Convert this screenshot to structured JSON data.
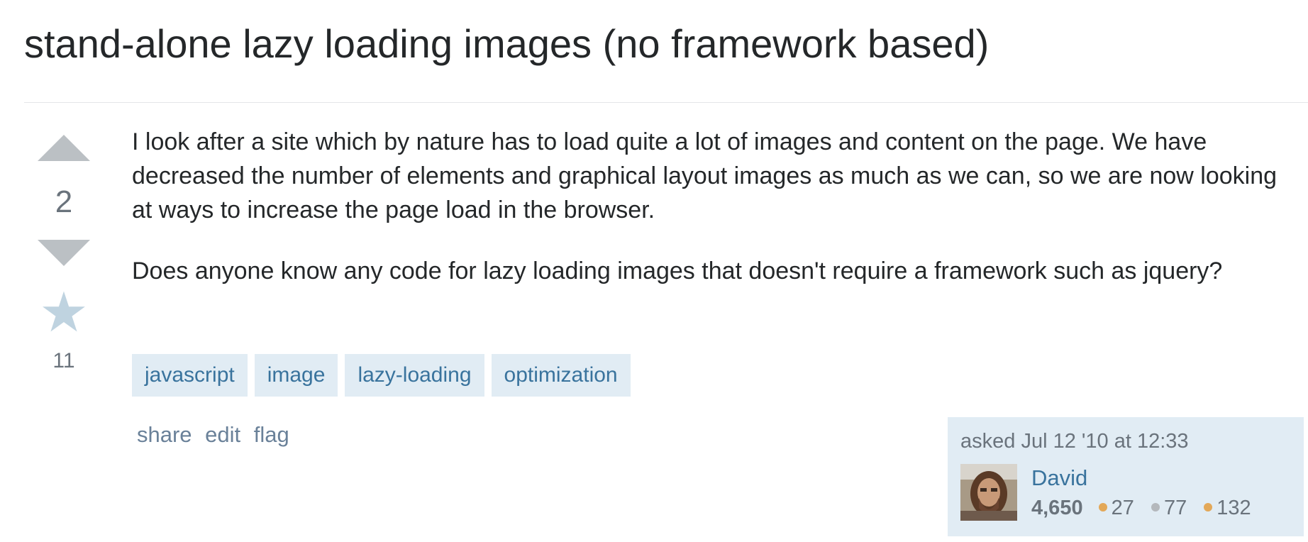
{
  "question": {
    "title": "stand-alone lazy loading images (no framework based)",
    "vote_count": "2",
    "favorite_count": "11",
    "body": [
      "I look after a site which by nature has to load quite a lot of images and content on the page. We have decreased the number of elements and graphical layout images as much as we can, so we are now looking at ways to increase the page load in the browser.",
      "Does anyone know any code for lazy loading images that doesn't require a framework such as jquery?"
    ],
    "tags": [
      "javascript",
      "image",
      "lazy-loading",
      "optimization"
    ]
  },
  "post_menu": {
    "share": "share",
    "edit": "edit",
    "flag": "flag"
  },
  "user_card": {
    "asked_label": "asked Jul 12 '10 at 12:33",
    "user_name": "David",
    "reputation": "4,650",
    "badges": {
      "gold": "27",
      "silver": "77",
      "bronze": "132"
    }
  },
  "colors": {
    "gold_badge": "#e3a858",
    "silver_badge": "#b4b8bc",
    "bronze_badge": "#e3a858",
    "tag_bg": "#e1ecf4",
    "tag_text": "#39739d",
    "vote_arrow": "#bbc0c4"
  },
  "icons": {
    "vote_up": "triangle-up",
    "vote_down": "triangle-down",
    "favorite": "star"
  }
}
